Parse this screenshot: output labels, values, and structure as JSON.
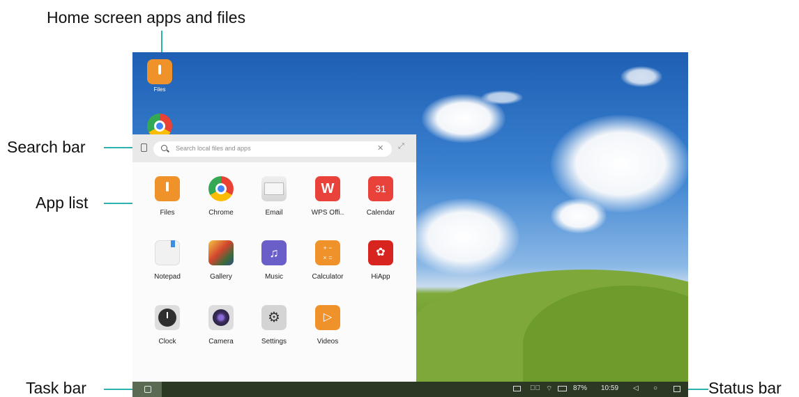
{
  "callouts": {
    "home": "Home screen apps and files",
    "search": "Search bar",
    "applist": "App list",
    "taskbar": "Task bar",
    "statusbar": "Status bar"
  },
  "desktop": {
    "icons": [
      {
        "label": "Files",
        "icon": "files-icon"
      },
      {
        "label": "",
        "icon": "chrome-icon"
      }
    ]
  },
  "drawer": {
    "search_placeholder": "Search local files and apps",
    "apps": [
      {
        "label": "Files",
        "icon": "files-icon",
        "color": "#f0922a"
      },
      {
        "label": "Chrome",
        "icon": "chrome-icon",
        "color": "#e94235"
      },
      {
        "label": "Email",
        "icon": "email-icon",
        "color": "#d9d9d9"
      },
      {
        "label": "WPS Offi..",
        "icon": "wps-office-icon",
        "color": "#e8423a"
      },
      {
        "label": "Calendar",
        "icon": "calendar-icon",
        "color": "#e8423a",
        "text": "31"
      },
      {
        "label": "Notepad",
        "icon": "notepad-icon",
        "color": "#f1f1f1"
      },
      {
        "label": "Gallery",
        "icon": "gallery-icon",
        "color": "#3c6b3a"
      },
      {
        "label": "Music",
        "icon": "music-icon",
        "color": "#6a5fc8"
      },
      {
        "label": "Calculator",
        "icon": "calculator-icon",
        "color": "#f0922a"
      },
      {
        "label": "HiApp",
        "icon": "hiapp-icon",
        "color": "#d8241f"
      },
      {
        "label": "Clock",
        "icon": "clock-icon",
        "color": "#3a3a3a"
      },
      {
        "label": "Camera",
        "icon": "camera-icon",
        "color": "#3b2d5e"
      },
      {
        "label": "Settings",
        "icon": "settings-icon",
        "color": "#d4d4d4"
      },
      {
        "label": "Videos",
        "icon": "videos-icon",
        "color": "#f0922a"
      }
    ]
  },
  "statusbar": {
    "battery": "87%",
    "time": "10:59"
  }
}
